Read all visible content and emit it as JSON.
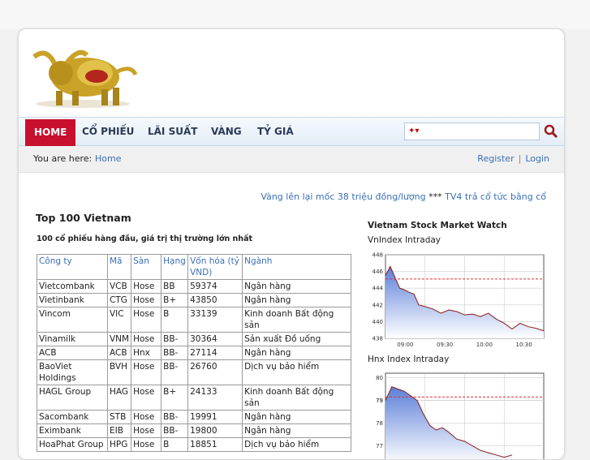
{
  "nav": {
    "items": [
      "HOME",
      "CỔ PHIẾU",
      "LÃI SUẤT",
      "VÀNG",
      "TỶ GIÁ"
    ]
  },
  "breadcrumb": {
    "label": "You are here:",
    "home": "Home",
    "register": "Register",
    "separator": "|",
    "login": "Login"
  },
  "ticker": {
    "text1": "Vàng lên lại mốc 38 triệu đồng/lượng",
    "stars": "***",
    "text2": "TV4 trả cổ tức bằng cổ"
  },
  "main": {
    "title": "Top 100 Vietnam",
    "subtitle": "100 cổ phiếu hàng đầu, giá trị thị trường lớn nhất",
    "table": {
      "headers": [
        "Công ty",
        "Mã",
        "Sàn",
        "Hạng",
        "Vốn hóa (tỷ VND)",
        "Ngành"
      ],
      "rows": [
        [
          "Vietcombank",
          "VCB",
          "Hose",
          "BB",
          "59374",
          "Ngân hàng"
        ],
        [
          "Vietinbank",
          "CTG",
          "Hose",
          "B+",
          "43850",
          "Ngân hàng"
        ],
        [
          "Vincom",
          "VIC",
          "Hose",
          "B",
          "33139",
          "Kinh doanh Bất động sản"
        ],
        [
          "Vinamilk",
          "VNM",
          "Hose",
          "BB-",
          "30364",
          "Sản xuất Đồ uống"
        ],
        [
          "ACB",
          "ACB",
          "Hnx",
          "BB-",
          "27114",
          "Ngân hàng"
        ],
        [
          "BaoViet Holdings",
          "BVH",
          "Hose",
          "BB-",
          "26760",
          "Dịch vụ bảo hiểm"
        ],
        [
          "HAGL Group",
          "HAG",
          "Hose",
          "B+",
          "24133",
          "Kinh doanh Bất động sản"
        ],
        [
          "Sacombank",
          "STB",
          "Hose",
          "BB-",
          "19991",
          "Ngân hàng"
        ],
        [
          "Eximbank",
          "EIB",
          "Hose",
          "BB-",
          "19800",
          "Ngân hàng"
        ],
        [
          "HoaPhat Group",
          "HPG",
          "Hose",
          "B",
          "18851",
          "Dịch vụ bảo hiểm"
        ]
      ]
    }
  },
  "sidebar": {
    "title": "Vietnam Stock Market Watch",
    "vn_label": "VnIndex Intraday",
    "hnx_label": "Hnx Index Intraday"
  },
  "colors": {
    "accent": "#c8102e",
    "link": "#3b6fb6",
    "chart_fill_top": "#5b7fd9",
    "chart_line": "#8b1a1a",
    "reference_line": "#e03030"
  },
  "chart_data": [
    {
      "type": "area",
      "title": "VnIndex Intraday",
      "x_ticks": [
        "09:00",
        "09:30",
        "10:00",
        "10:30"
      ],
      "y_ticks": [
        438,
        440,
        442,
        444,
        446,
        448
      ],
      "ylim": [
        438,
        448
      ],
      "reference": 445.1,
      "x": [
        0,
        3,
        6,
        9,
        12,
        15,
        18,
        21,
        25,
        30,
        35,
        40,
        45,
        50,
        55,
        60,
        65,
        70,
        75,
        80,
        85,
        90,
        95,
        100
      ],
      "values": [
        445.5,
        446.6,
        445.3,
        444.0,
        443.8,
        443.5,
        443.3,
        442.0,
        441.8,
        441.5,
        441.0,
        441.4,
        441.2,
        440.8,
        440.9,
        440.6,
        441.0,
        440.3,
        439.8,
        439.1,
        439.8,
        439.4,
        439.2,
        438.9
      ],
      "grid": true
    },
    {
      "type": "area",
      "title": "Hnx Index Intraday",
      "y_ticks": [
        77,
        78,
        79,
        79,
        80
      ],
      "ylim": [
        76.2,
        80.2
      ],
      "reference": 79.15,
      "x": [
        0,
        4,
        8,
        12,
        16,
        20,
        24,
        28,
        32,
        36,
        40,
        45,
        50,
        55,
        60,
        65,
        70,
        75,
        80
      ],
      "values": [
        79.0,
        79.6,
        79.5,
        79.4,
        79.2,
        79.0,
        78.4,
        77.9,
        77.7,
        77.8,
        77.6,
        77.3,
        77.2,
        77.0,
        76.8,
        76.7,
        76.6,
        76.5,
        76.6
      ],
      "grid": true
    }
  ]
}
